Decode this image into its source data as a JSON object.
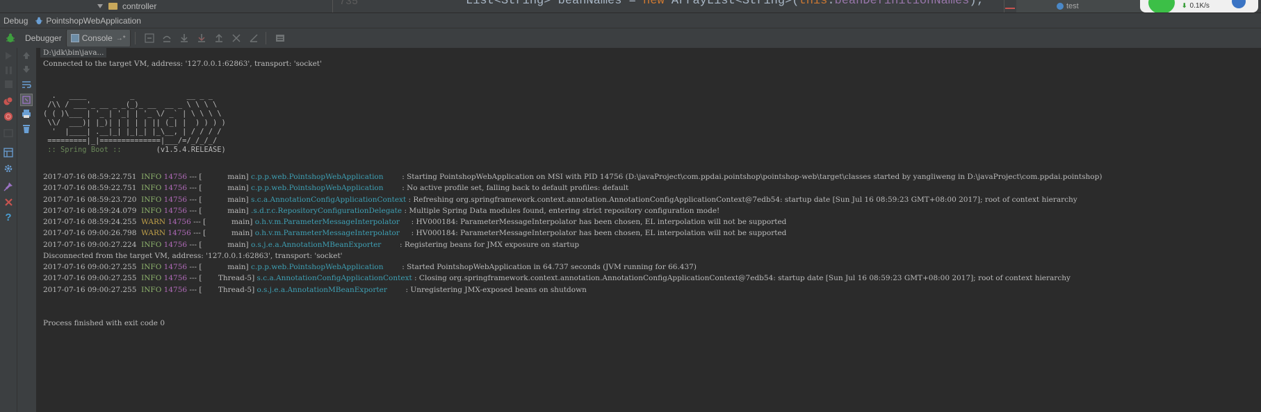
{
  "topbar": {
    "tree_item": "controller",
    "line_number": "735",
    "code_parts": [
      "List<String> beanNames = ",
      "new",
      " ArrayList<String>(",
      "this",
      ".",
      "beanDefinitionNames",
      ");"
    ],
    "status_label": "test",
    "net_speed": "0.1K/s"
  },
  "titlebar": {
    "section": "Debug",
    "config": "PointshopWebApplication"
  },
  "tabs": [
    {
      "label": "Debugger"
    },
    {
      "label": "Console"
    }
  ],
  "console": {
    "command": "D:\\jdk\\bin\\java...",
    "connected": "Connected to the target VM, address: '127.0.0.1:62863', transport: 'socket'",
    "banner": [
      "  .   ____          _            __ _ _",
      " /\\\\ / ___'_ __ _ _(_)_ __  __ _ \\ \\ \\ \\",
      "( ( )\\___ | '_ | '_| | '_ \\/ _` | \\ \\ \\ \\",
      " \\\\/  ___)| |_)| | | | | || (_| |  ) ) ) )",
      "  '  |____| .__|_| |_|_| |_\\__, | / / / /",
      " =========|_|==============|___/=/_/_/_/"
    ],
    "spring_label": " :: Spring Boot :: ",
    "spring_version": "       (v1.5.4.RELEASE)",
    "logs": [
      {
        "ts": "2017-07-16 08:59:22.751",
        "level": "INFO",
        "pid": "14756",
        "sep": "--- [",
        "thread": "main]",
        "logger": "c.p.p.web.PointshopWebApplication",
        "msg": ": Starting PointshopWebApplication on MSI with PID 14756 (D:\\javaProject\\com.ppdai.pointshop\\pointshop-web\\target\\classes started by yangliweng in D:\\javaProject\\com.ppdai.pointshop)"
      },
      {
        "ts": "2017-07-16 08:59:22.751",
        "level": "INFO",
        "pid": "14756",
        "sep": "--- [",
        "thread": "main]",
        "logger": "c.p.p.web.PointshopWebApplication",
        "msg": ": No active profile set, falling back to default profiles: default"
      },
      {
        "ts": "2017-07-16 08:59:23.720",
        "level": "INFO",
        "pid": "14756",
        "sep": "--- [",
        "thread": "main]",
        "logger": "s.c.a.AnnotationConfigApplicationContext",
        "msg": ": Refreshing org.springframework.context.annotation.AnnotationConfigApplicationContext@7edb54: startup date [Sun Jul 16 08:59:23 GMT+08:00 2017]; root of context hierarchy"
      },
      {
        "ts": "2017-07-16 08:59:24.079",
        "level": "INFO",
        "pid": "14756",
        "sep": "--- [",
        "thread": "main]",
        "logger": ".s.d.r.c.RepositoryConfigurationDelegate",
        "msg": ": Multiple Spring Data modules found, entering strict repository configuration mode!"
      },
      {
        "ts": "2017-07-16 08:59:24.255",
        "level": "WARN",
        "pid": "14756",
        "sep": "--- [",
        "thread": "main]",
        "logger": "o.h.v.m.ParameterMessageInterpolator",
        "msg": ": HV000184: ParameterMessageInterpolator has been chosen, EL interpolation will not be supported"
      },
      {
        "ts": "2017-07-16 09:00:26.798",
        "level": "WARN",
        "pid": "14756",
        "sep": "--- [",
        "thread": "main]",
        "logger": "o.h.v.m.ParameterMessageInterpolator",
        "msg": ": HV000184: ParameterMessageInterpolator has been chosen, EL interpolation will not be supported"
      },
      {
        "ts": "2017-07-16 09:00:27.224",
        "level": "INFO",
        "pid": "14756",
        "sep": "--- [",
        "thread": "main]",
        "logger": "o.s.j.e.a.AnnotationMBeanExporter",
        "msg": ": Registering beans for JMX exposure on startup"
      }
    ],
    "disconnected": "Disconnected from the target VM, address: '127.0.0.1:62863', transport: 'socket'",
    "logs2": [
      {
        "ts": "2017-07-16 09:00:27.255",
        "level": "INFO",
        "pid": "14756",
        "sep": "--- [",
        "thread": "main]",
        "logger": "c.p.p.web.PointshopWebApplication",
        "msg": ": Started PointshopWebApplication in 64.737 seconds (JVM running for 66.437)"
      },
      {
        "ts": "2017-07-16 09:00:27.255",
        "level": "INFO",
        "pid": "14756",
        "sep": "--- [",
        "thread": "Thread-5]",
        "logger": "s.c.a.AnnotationConfigApplicationContext",
        "msg": ": Closing org.springframework.context.annotation.AnnotationConfigApplicationContext@7edb54: startup date [Sun Jul 16 08:59:23 GMT+08:00 2017]; root of context hierarchy"
      },
      {
        "ts": "2017-07-16 09:00:27.255",
        "level": "INFO",
        "pid": "14756",
        "sep": "--- [",
        "thread": "Thread-5]",
        "logger": "o.s.j.e.a.AnnotationMBeanExporter",
        "msg": ": Unregistering JMX-exposed beans on shutdown"
      }
    ],
    "finished": "Process finished with exit code 0"
  },
  "colors": {
    "background": "#2b2b2b",
    "info": "#8eb36c",
    "warn": "#c2a24a",
    "pid": "#b06ab8",
    "logger": "#3e9fb3"
  }
}
